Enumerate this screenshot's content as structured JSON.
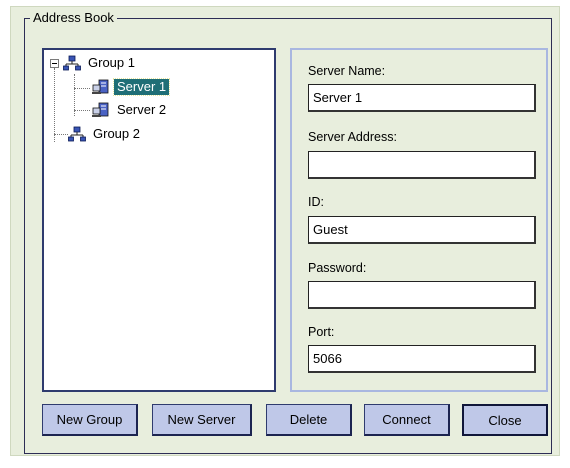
{
  "dialog": {
    "group_title": "Address Book"
  },
  "tree": {
    "nodes": [
      {
        "label": "Group 1",
        "type": "group",
        "expanded": true
      },
      {
        "label": "Server 1",
        "type": "server",
        "selected": true
      },
      {
        "label": "Server 2",
        "type": "server"
      },
      {
        "label": "Group 2",
        "type": "group"
      }
    ]
  },
  "form": {
    "server_name_label": "Server Name:",
    "server_name_value": "Server 1",
    "server_address_label": "Server Address:",
    "server_address_value": "",
    "id_label": "ID:",
    "id_value": "Guest",
    "password_label": "Password:",
    "password_value": "",
    "port_label": "Port:",
    "port_value": "5066"
  },
  "buttons": {
    "new_group": "New Group",
    "new_server": "New Server",
    "delete": "Delete",
    "connect": "Connect",
    "close": "Close"
  },
  "colors": {
    "dialog_bg": "#e8eedd",
    "selection": "#1f6e76",
    "button_bg": "#bfc8e8"
  }
}
